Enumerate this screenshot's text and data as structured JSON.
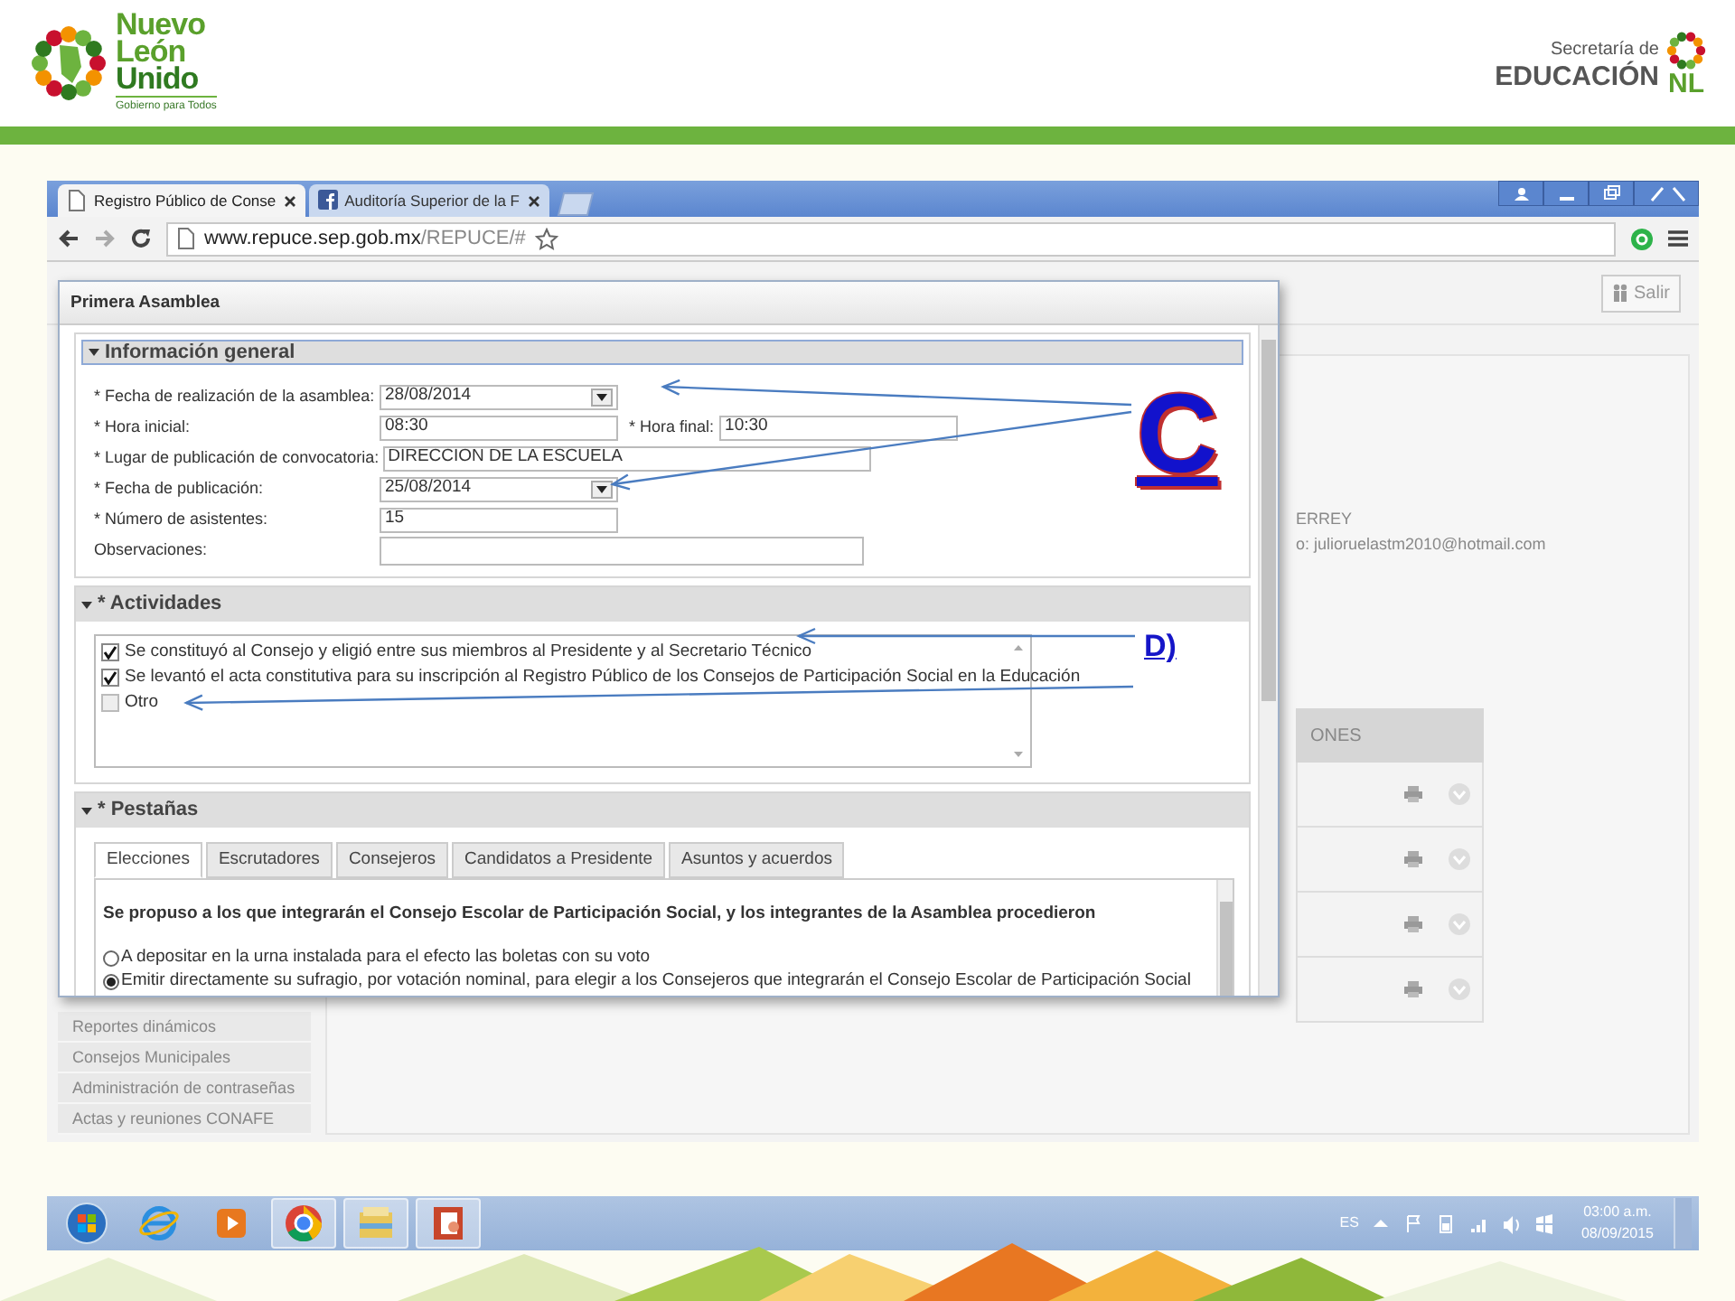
{
  "header": {
    "left_logo": {
      "lines": [
        "Nuevo",
        "León",
        "Unido"
      ],
      "tagline": "Gobierno para Todos"
    },
    "right_logo": {
      "top": "Secretaría de",
      "main": "EDUCACIÓN",
      "badge": "NL"
    }
  },
  "browser": {
    "tabs": [
      {
        "title": "Registro Público de Conse",
        "selected": true,
        "kind": "page"
      },
      {
        "title": "Auditoría Superior de la F",
        "selected": false,
        "kind": "facebook"
      }
    ],
    "url_host": "www.repuce.sep.gob.mx",
    "url_path": "/REPUCE/#"
  },
  "page": {
    "logout_button": "Salir",
    "background_texts": [
      "ERREY",
      "o: julioruelastm2010@hotmail.com"
    ],
    "table_header": "ONES",
    "sidebar": [
      "Reportes dinámicos",
      "Consejos Municipales",
      "Administración de contraseñas",
      "Actas y reuniones CONAFE"
    ]
  },
  "modal": {
    "title": "Primera Asamblea",
    "general": {
      "title": "Información general",
      "expanded": true,
      "rows": [
        {
          "fields": [
            {
              "label": "* Fecha de realización de la asamblea:",
              "value": "28/08/2014",
              "kind": "date"
            }
          ]
        },
        {
          "fields": [
            {
              "label": "* Hora inicial:",
              "value": "08:30",
              "kind": "text"
            },
            {
              "label": "* Hora final:",
              "value": "10:30",
              "kind": "text"
            }
          ]
        },
        {
          "fields": [
            {
              "label": "* Lugar de publicación de convocatoria:",
              "value": "DIRECCION DE LA ESCUELA",
              "kind": "text"
            }
          ]
        },
        {
          "fields": [
            {
              "label": "* Fecha de publicación:",
              "value": "25/08/2014",
              "kind": "date"
            }
          ]
        },
        {
          "fields": [
            {
              "label": "* Número de asistentes:",
              "value": "15",
              "kind": "text"
            }
          ]
        },
        {
          "fields": [
            {
              "label": "Observaciones:",
              "kind": "text"
            }
          ]
        }
      ]
    },
    "activities": {
      "title": "* Actividades",
      "expanded": true,
      "items": [
        {
          "label": "Se constituyó al Consejo y eligió entre sus miembros al Presidente y al Secretario Técnico",
          "checked": true
        },
        {
          "label": "Se levantó el acta constitutiva para su inscripción al Registro Público de los Consejos de Participación Social en la Educación",
          "checked": true
        },
        {
          "label": "Otro",
          "checked": false
        }
      ]
    },
    "tabs_section": {
      "title": "* Pestañas",
      "expanded": true,
      "tabs": [
        {
          "label": "Elecciones",
          "selected": true
        },
        {
          "label": "Escrutadores",
          "selected": false
        },
        {
          "label": "Consejeros",
          "selected": false
        },
        {
          "label": "Candidatos a Presidente",
          "selected": false
        },
        {
          "label": "Asuntos y acuerdos",
          "selected": false
        }
      ],
      "question": "Se propuso a los que integrarán el Consejo Escolar de Participación Social, y los integrantes de la Asamblea procedieron",
      "options": [
        {
          "label": "A depositar en la urna instalada para el efecto las boletas con su voto",
          "selected": false
        },
        {
          "label": "Emitir directamente su sufragio, por votación nominal, para elegir a los Consejeros que integrarán el Consejo Escolar de Participación Social",
          "selected": true
        }
      ]
    }
  },
  "annotations": [
    {
      "label": "C"
    },
    {
      "label": "D)"
    }
  ],
  "taskbar": {
    "language": "ES",
    "time": "03:00 a.m.",
    "date": "08/09/2015"
  }
}
